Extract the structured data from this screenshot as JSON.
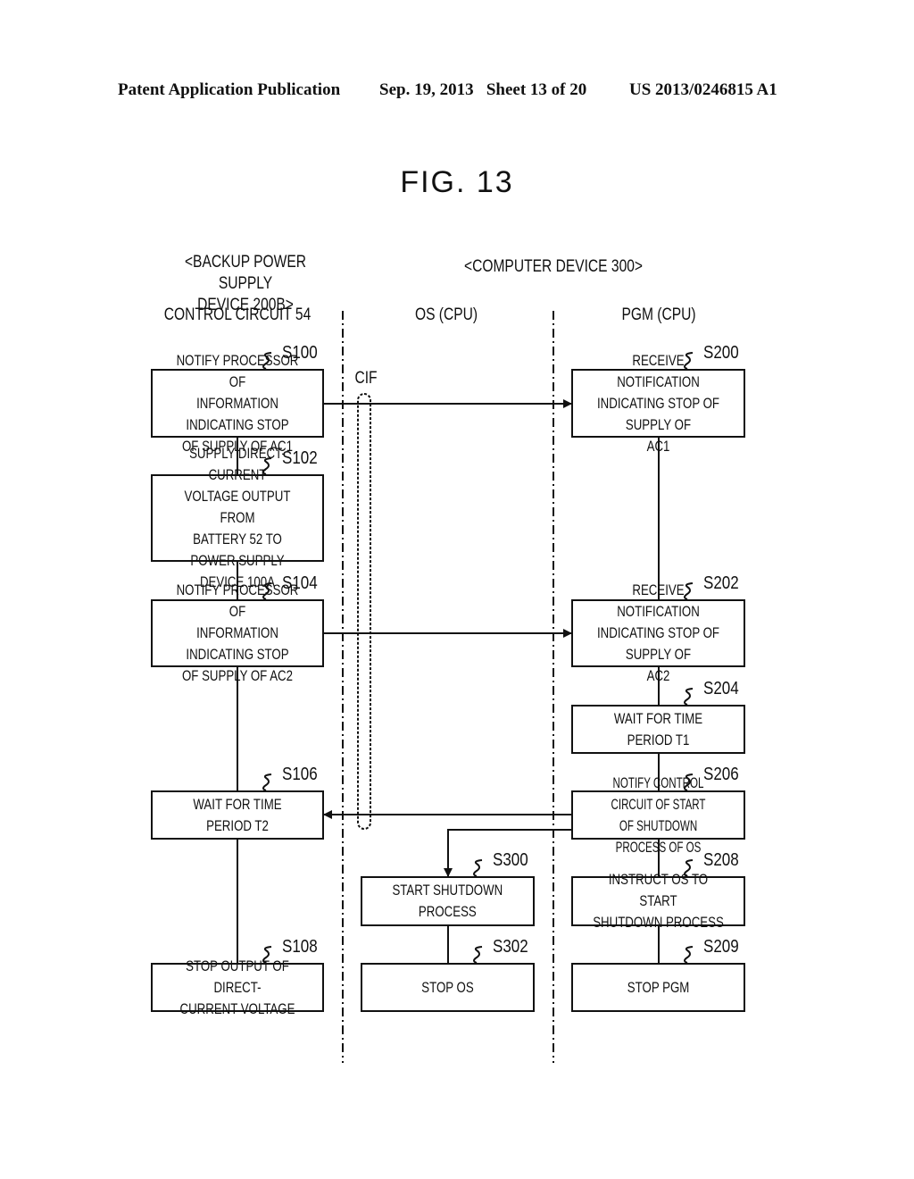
{
  "header": {
    "publication": "Patent Application Publication",
    "date_sheet": "Sep. 19, 2013   Sheet 13 of 20",
    "number": "US 2013/0246815 A1"
  },
  "figure_title": "FIG. 13",
  "groups": {
    "backup": "<BACKUP POWER SUPPLY\nDEVICE 200B>",
    "computer": "<COMPUTER DEVICE 300>"
  },
  "lanes": {
    "control": "CONTROL CIRCUIT 54",
    "os": "OS (CPU)",
    "pgm": "PGM (CPU)"
  },
  "interface_label": "CIF",
  "steps": {
    "s100": {
      "id": "S100",
      "text": "NOTIFY PROCESSOR OF\nINFORMATION INDICATING STOP\nOF SUPPLY OF AC1"
    },
    "s102": {
      "id": "S102",
      "text": "SUPPLY DIRECT-CURRENT\nVOLTAGE OUTPUT FROM\nBATTERY 52 TO POWER SUPPLY\nDEVICE 100A"
    },
    "s104": {
      "id": "S104",
      "text": "NOTIFY PROCESSOR OF\nINFORMATION INDICATING STOP\nOF SUPPLY OF AC2"
    },
    "s106": {
      "id": "S106",
      "text": "WAIT FOR TIME PERIOD T2"
    },
    "s108": {
      "id": "S108",
      "text": "STOP OUTPUT OF DIRECT-\nCURRENT VOLTAGE"
    },
    "s200": {
      "id": "S200",
      "text": "RECEIVE NOTIFICATION\nINDICATING STOP OF SUPPLY OF\nAC1"
    },
    "s202": {
      "id": "S202",
      "text": "RECEIVE NOTIFICATION\nINDICATING STOP OF SUPPLY OF\nAC2"
    },
    "s204": {
      "id": "S204",
      "text": "WAIT FOR TIME PERIOD T1"
    },
    "s206": {
      "id": "S206",
      "text": "NOTIFY CONTROL CIRCUIT OF START\nOF SHUTDOWN PROCESS OF OS"
    },
    "s208": {
      "id": "S208",
      "text": "INSTRUCT OS TO START\nSHUTDOWN PROCESS"
    },
    "s209": {
      "id": "S209",
      "text": "STOP PGM"
    },
    "s300": {
      "id": "S300",
      "text": "START SHUTDOWN\nPROCESS"
    },
    "s302": {
      "id": "S302",
      "text": "STOP OS"
    }
  }
}
